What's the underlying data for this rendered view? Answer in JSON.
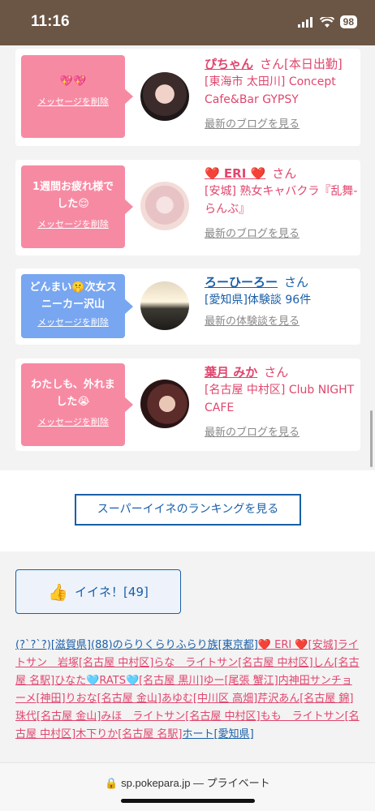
{
  "status": {
    "time": "11:16",
    "battery": "98"
  },
  "cards": [
    {
      "color": "pink",
      "message": "💖💖",
      "delete": "メッセージを削除",
      "name": "ぴちゃん",
      "san": "さん",
      "name_suffix": "[本日出勤]",
      "location": "[東海市 太田川] Concept Cafe&Bar GYPSY",
      "link": "最新のブログを見る"
    },
    {
      "color": "pink",
      "message": "1週間お疲れ様でした😌",
      "delete": "メッセージを削除",
      "name": "❤️ ERI ❤️",
      "san": "さん",
      "name_suffix": "",
      "location": "[安城] 熟女キャバクラ『乱舞-らんぶ』",
      "link": "最新のブログを見る"
    },
    {
      "color": "blue",
      "message": "どんまい🤫次女スニーカー沢山",
      "delete": "メッセージを削除",
      "name": "ろーひーろー",
      "san": "さん",
      "name_suffix": "",
      "location": "[愛知県]体験談 96件",
      "link": "最新の体験談を見る"
    },
    {
      "color": "pink",
      "message": "わたしも、外れました😭",
      "delete": "メッセージを削除",
      "name": "葉月 みか",
      "san": "さん",
      "name_suffix": "",
      "location": "[名古屋 中村区] Club NIGHT CAFE",
      "link": "最新のブログを見る"
    }
  ],
  "ranking_button": "スーパーイイネのランキングを見る",
  "like_button": {
    "label": "イイネ！[49]",
    "icon": "thumbs-up-icon"
  },
  "likers": [
    {
      "text": "(?`?`?)[滋賀県]",
      "color": "blue"
    },
    {
      "text": "(88)のらりくらりふらり族[東京都]",
      "color": "blue"
    },
    {
      "text": "❤️ ERI ❤️[安城]",
      "color": "pink"
    },
    {
      "text": "ライトサン　岩塚[名古屋 中村区]",
      "color": "pink"
    },
    {
      "text": "らな　ライトサン[名古屋 中村区]",
      "color": "pink"
    },
    {
      "text": "しん[名古屋 名駅]",
      "color": "pink"
    },
    {
      "text": "ひなた🩵RATS🩵[名古屋 黒川]",
      "color": "pink"
    },
    {
      "text": "ゆー[尾張 蟹江]",
      "color": "pink"
    },
    {
      "text": "内神田サンチョーメ[神田]",
      "color": "pink"
    },
    {
      "text": "りおな[名古屋 金山]",
      "color": "pink"
    },
    {
      "text": "あゆむ[中川区 高畑]",
      "color": "pink"
    },
    {
      "text": "芹沢あん[名古屋 錦]",
      "color": "pink"
    },
    {
      "text": "珠代[名古屋 金山]",
      "color": "pink"
    },
    {
      "text": "みほ　ライトサン[名古屋 中村区]",
      "color": "pink"
    },
    {
      "text": "もも　ライトサン[名古屋 中村区]",
      "color": "pink"
    },
    {
      "text": "木下りか[名古屋 名駅]",
      "color": "pink"
    },
    {
      "text": "ホート[愛知県]",
      "color": "blue"
    }
  ],
  "bottom_bar": {
    "url": "sp.pokepara.jp",
    "private_label": "— プライベート"
  }
}
